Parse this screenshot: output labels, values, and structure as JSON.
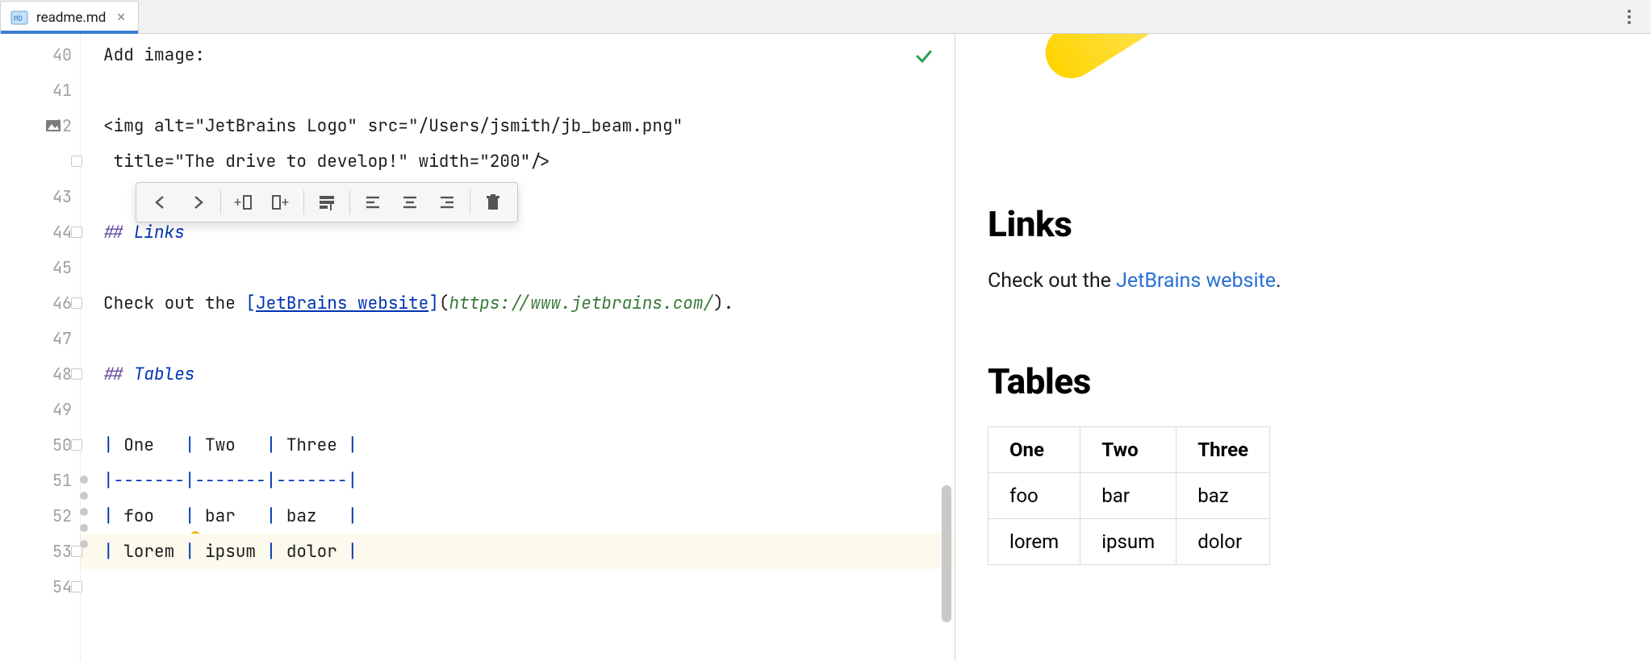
{
  "tab": {
    "label": "readme.md"
  },
  "gutter": {
    "lines": [
      40,
      41,
      42,
      43,
      44,
      45,
      46,
      47,
      48,
      49,
      50,
      51,
      52,
      53,
      54
    ]
  },
  "code": {
    "l40": "Add image:",
    "l42a": "<img alt=\"JetBrains Logo\" src=\"/Users/jsmith/jb_beam.png\"",
    "l42b": " title=\"The drive to develop!\" width=\"200\"/>",
    "l44_hash": "## ",
    "l44_text": "Links",
    "l46_pre": "Check out the ",
    "l46_lb": "[",
    "l46_linktext": "JetBrains website",
    "l46_rb": "]",
    "l46_lp": "(",
    "l46_url": "https://www.jetbrains.com/",
    "l46_rp": ")",
    "l46_dot": ".",
    "l48_hash": "## ",
    "l48_text": "Tables",
    "table_header": {
      "p": "| ",
      "c1": "One   ",
      "s1": "| ",
      "c2": "Two   ",
      "s2": "| ",
      "c3": "Three ",
      "e": "|"
    },
    "table_sep": {
      "p": "|",
      "c1": "-------",
      "s1": "|",
      "c2": "-------",
      "s2": "|",
      "c3": "-------",
      "e": "|"
    },
    "table_r1": {
      "p": "| ",
      "c1": "foo   ",
      "s1": "| ",
      "c2": "bar   ",
      "s2": "| ",
      "c3": "baz   ",
      "e": "|"
    },
    "table_r2": {
      "p": "| ",
      "c1": "lorem ",
      "s1": "| ",
      "c2": "ipsum ",
      "s2": "| ",
      "c3": "dolor ",
      "e": "|"
    }
  },
  "preview": {
    "h_links": "Links",
    "p_links_pre": "Check out the ",
    "p_links_link": "JetBrains website",
    "p_links_post": ".",
    "h_tables": "Tables",
    "table": {
      "head": [
        "One",
        "Two",
        "Three"
      ],
      "rows": [
        [
          "foo",
          "bar",
          "baz"
        ],
        [
          "lorem",
          "ipsum",
          "dolor"
        ]
      ]
    }
  }
}
